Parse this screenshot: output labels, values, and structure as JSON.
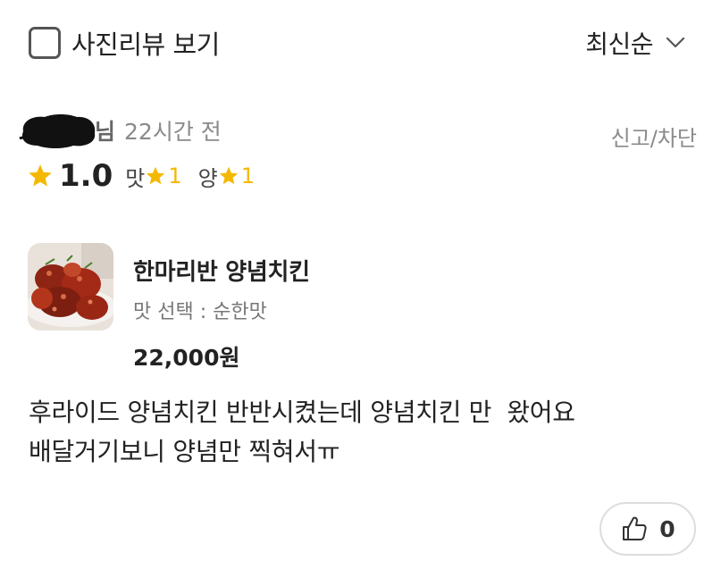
{
  "filter": {
    "photo_review_label": "사진리뷰 보기",
    "checked": false
  },
  "sort": {
    "selected": "최신순"
  },
  "review": {
    "nickname_suffix": "님",
    "time_ago": "22시간 전",
    "report_label": "신고/차단",
    "rating": {
      "overall": "1.0",
      "taste_label": "맛",
      "taste_value": "1",
      "amount_label": "양",
      "amount_value": "1"
    },
    "menu": {
      "name": "한마리반 양념치킨",
      "option": "맛 선택 : 순한맛",
      "price": "22,000원"
    },
    "body_lines": [
      "후라이드 양념치킨 반반시켰는데 양념치킨 만  왔어요",
      "배달거기보니 양념만 찍혀서ㅠ"
    ],
    "likes": "0"
  },
  "colors": {
    "star": "#f5b800",
    "text_primary": "#222222",
    "text_secondary": "#8a8a8a"
  },
  "icons": {
    "checkbox": "checkbox-icon",
    "sort": "chevron-down-icon",
    "star": "star-icon",
    "like": "thumbs-up-icon"
  }
}
